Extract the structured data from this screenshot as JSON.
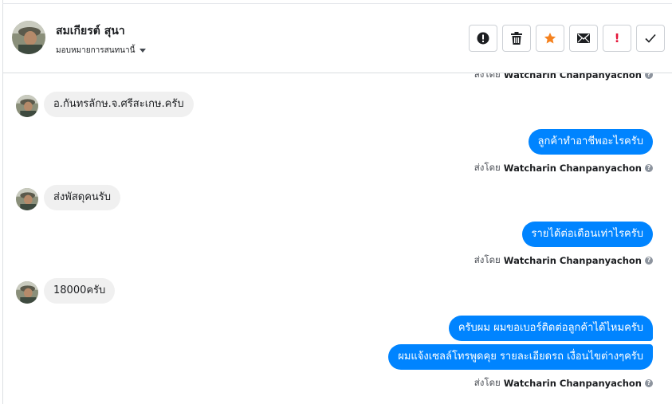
{
  "header": {
    "contact_name": "สมเกียรต์ สุนา",
    "assign_label": "มอบหมายการสนทนานี้",
    "actions": [
      {
        "icon": "alert-circle-icon"
      },
      {
        "icon": "trash-icon"
      },
      {
        "icon": "star-icon",
        "color": "#f5821f"
      },
      {
        "icon": "mail-icon"
      },
      {
        "icon": "exclamation-icon",
        "glyph": "!",
        "color": "#e4163a"
      },
      {
        "icon": "check-icon"
      }
    ]
  },
  "chat": {
    "top_sent_by": {
      "prefix": "ส่งโดย",
      "agent": "Watcharin Chanpanyachon"
    },
    "messages": [
      {
        "direction": "in",
        "text": "อ.กันทรลักษ.จ.ศรีสะเกษ.ครับ"
      },
      {
        "direction": "out",
        "text": "ลูกค้าทำอาชีพอะไรครับ"
      },
      {
        "direction": "out_meta",
        "prefix": "ส่งโดย",
        "agent": "Watcharin Chanpanyachon"
      },
      {
        "direction": "in",
        "text": "ส่งพัสดุคนรับ"
      },
      {
        "direction": "out",
        "text": "รายได้ต่อเดือนเท่าไรครับ"
      },
      {
        "direction": "out_meta",
        "prefix": "ส่งโดย",
        "agent": "Watcharin Chanpanyachon"
      },
      {
        "direction": "in",
        "text": "18000ครับ"
      },
      {
        "direction": "out",
        "text": "ครับผม ผมขอเบอร์ติดต่อลูกค้าได้ไหมครับ"
      },
      {
        "direction": "out",
        "text": "ผมแจ้งเซลล์โทรพูดคุย รายละเอียดรถ เงื่อนไขต่างๆครับ"
      },
      {
        "direction": "out_meta",
        "prefix": "ส่งโดย",
        "agent": "Watcharin Chanpanyachon"
      }
    ]
  },
  "colors": {
    "outgoing_bubble": "#0084ff",
    "incoming_bubble": "#f0f0f0",
    "star_accent": "#f5821f",
    "alert_red": "#e4163a"
  }
}
